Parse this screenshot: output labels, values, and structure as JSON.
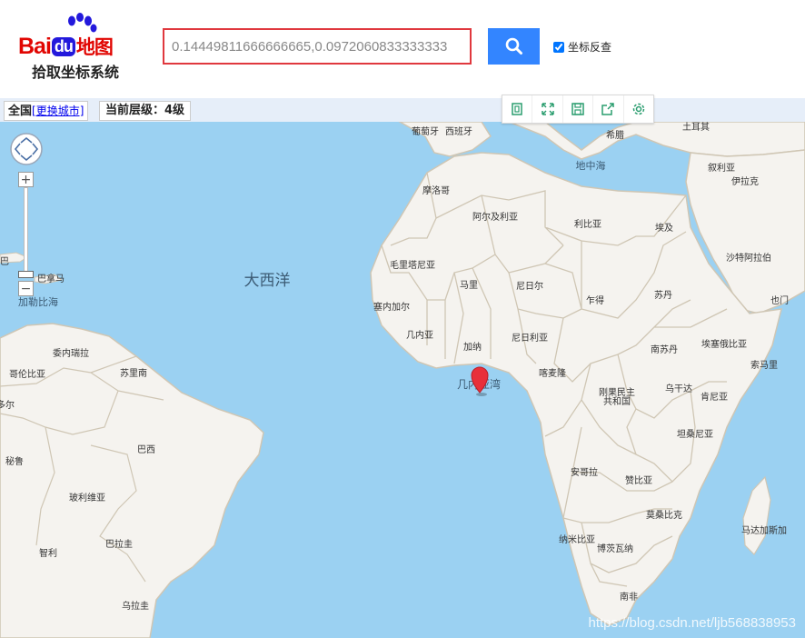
{
  "header": {
    "logo_bai": "Bai",
    "logo_du": "du",
    "logo_map": "地图",
    "logo_subtitle": "拾取坐标系统",
    "coord_value": "0.14449811666666665,0.0972060833333333",
    "reverse_label": "坐标反查",
    "reverse_checked": true
  },
  "toolbar": {
    "city_label": "全国",
    "change_city": "[更换城市]",
    "level_label": "当前层级：4级"
  },
  "map_tools": [
    "fit-icon",
    "fullscreen-icon",
    "save-icon",
    "share-icon",
    "settings-icon"
  ],
  "map": {
    "ocean_color": "#9bd1f2",
    "land_color": "#f5f3ef",
    "border_color": "#cfc6b4",
    "marker_color": "#e8303a",
    "ocean_labels": {
      "atlantic": "大西洋",
      "mediterranean": "地中海",
      "gulf_guinea": "几内亚湾",
      "caribbean": "加勒比海"
    },
    "countries": {
      "portugal": "葡萄牙",
      "spain": "西班牙",
      "greece": "希腊",
      "turkey": "土耳其",
      "morocco": "摩洛哥",
      "algeria": "阿尔及利亚",
      "libya": "利比亚",
      "egypt": "埃及",
      "syria": "叙利亚",
      "israel": "伊拉克",
      "saudi": "沙特阿拉伯",
      "yemen": "也门",
      "mauritania": "毛里塔尼亚",
      "mali": "马里",
      "niger": "尼日尔",
      "chad": "乍得",
      "sudan": "苏丹",
      "senegal": "塞内加尔",
      "guinea": "几内亚",
      "ghana": "加纳",
      "nigeria": "尼日利亚",
      "south_sudan": "南苏丹",
      "ethiopia": "埃塞俄比亚",
      "somalia": "索马里",
      "cameroon": "喀麦隆",
      "drc": "刚果民主\n共和国",
      "uganda": "乌干达",
      "kenya": "肯尼亚",
      "tanzania": "坦桑尼亚",
      "angola": "安哥拉",
      "zambia": "赞比亚",
      "mozambique": "莫桑比克",
      "namibia": "纳米比亚",
      "botswana": "博茨瓦纳",
      "south_africa": "南非",
      "madagascar": "马达加斯加",
      "venezuela": "委内瑞拉",
      "colombia": "哥伦比亚",
      "suriname": "苏里南",
      "brazil": "巴西",
      "peru": "秘鲁",
      "bolivia": "玻利维亚",
      "paraguay": "巴拉圭",
      "chile": "智利",
      "uruguay": "乌拉圭",
      "panama": "巴拿马",
      "cuba": "巴",
      "ecuador": "多尔"
    }
  },
  "watermark": "https://blog.csdn.net/ljb568838953"
}
